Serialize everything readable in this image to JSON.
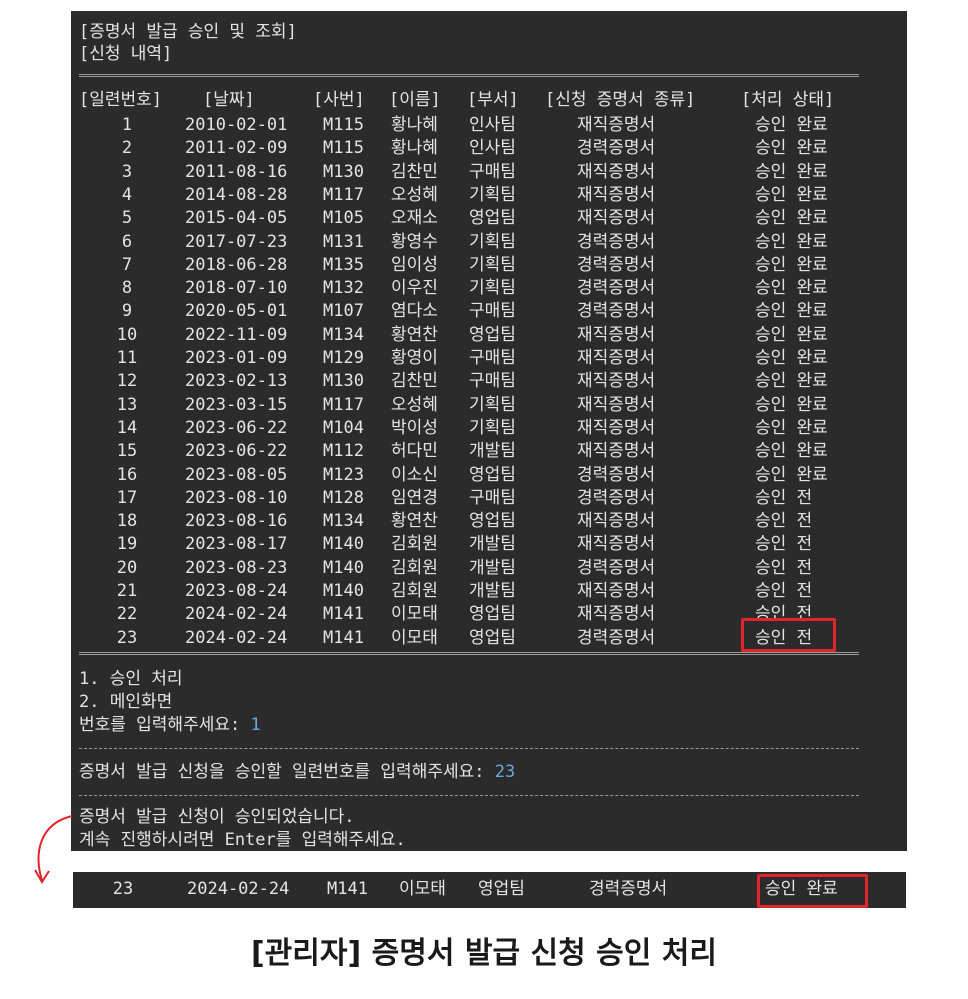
{
  "terminal": {
    "title": "[증명서 발급 승인 및 조회]",
    "subtitle": "[신청 내역]",
    "headers": [
      "[일련번호]",
      "[날짜]",
      "[사번]",
      "[이름]",
      "[부서]",
      "[신청 증명서 종류]",
      "[처리 상태]"
    ],
    "rows": [
      {
        "seq": "1",
        "date": "2010-02-01",
        "emp": "M115",
        "name": "황나혜",
        "dept": "인사팀",
        "type": "재직증명서",
        "status": "승인 완료"
      },
      {
        "seq": "2",
        "date": "2011-02-09",
        "emp": "M115",
        "name": "황나혜",
        "dept": "인사팀",
        "type": "경력증명서",
        "status": "승인 완료"
      },
      {
        "seq": "3",
        "date": "2011-08-16",
        "emp": "M130",
        "name": "김찬민",
        "dept": "구매팀",
        "type": "재직증명서",
        "status": "승인 완료"
      },
      {
        "seq": "4",
        "date": "2014-08-28",
        "emp": "M117",
        "name": "오성혜",
        "dept": "기획팀",
        "type": "재직증명서",
        "status": "승인 완료"
      },
      {
        "seq": "5",
        "date": "2015-04-05",
        "emp": "M105",
        "name": "오재소",
        "dept": "영업팀",
        "type": "재직증명서",
        "status": "승인 완료"
      },
      {
        "seq": "6",
        "date": "2017-07-23",
        "emp": "M131",
        "name": "황영수",
        "dept": "기획팀",
        "type": "경력증명서",
        "status": "승인 완료"
      },
      {
        "seq": "7",
        "date": "2018-06-28",
        "emp": "M135",
        "name": "임이성",
        "dept": "기획팀",
        "type": "경력증명서",
        "status": "승인 완료"
      },
      {
        "seq": "8",
        "date": "2018-07-10",
        "emp": "M132",
        "name": "이우진",
        "dept": "기획팀",
        "type": "경력증명서",
        "status": "승인 완료"
      },
      {
        "seq": "9",
        "date": "2020-05-01",
        "emp": "M107",
        "name": "염다소",
        "dept": "구매팀",
        "type": "경력증명서",
        "status": "승인 완료"
      },
      {
        "seq": "10",
        "date": "2022-11-09",
        "emp": "M134",
        "name": "황연찬",
        "dept": "영업팀",
        "type": "재직증명서",
        "status": "승인 완료"
      },
      {
        "seq": "11",
        "date": "2023-01-09",
        "emp": "M129",
        "name": "황영이",
        "dept": "구매팀",
        "type": "재직증명서",
        "status": "승인 완료"
      },
      {
        "seq": "12",
        "date": "2023-02-13",
        "emp": "M130",
        "name": "김찬민",
        "dept": "구매팀",
        "type": "재직증명서",
        "status": "승인 완료"
      },
      {
        "seq": "13",
        "date": "2023-03-15",
        "emp": "M117",
        "name": "오성혜",
        "dept": "기획팀",
        "type": "재직증명서",
        "status": "승인 완료"
      },
      {
        "seq": "14",
        "date": "2023-06-22",
        "emp": "M104",
        "name": "박이성",
        "dept": "기획팀",
        "type": "재직증명서",
        "status": "승인 완료"
      },
      {
        "seq": "15",
        "date": "2023-06-22",
        "emp": "M112",
        "name": "허다민",
        "dept": "개발팀",
        "type": "재직증명서",
        "status": "승인 완료"
      },
      {
        "seq": "16",
        "date": "2023-08-05",
        "emp": "M123",
        "name": "이소신",
        "dept": "영업팀",
        "type": "경력증명서",
        "status": "승인 완료"
      },
      {
        "seq": "17",
        "date": "2023-08-10",
        "emp": "M128",
        "name": "임연경",
        "dept": "구매팀",
        "type": "경력증명서",
        "status": "승인 전"
      },
      {
        "seq": "18",
        "date": "2023-08-16",
        "emp": "M134",
        "name": "황연찬",
        "dept": "영업팀",
        "type": "재직증명서",
        "status": "승인 전"
      },
      {
        "seq": "19",
        "date": "2023-08-17",
        "emp": "M140",
        "name": "김회원",
        "dept": "개발팀",
        "type": "재직증명서",
        "status": "승인 전"
      },
      {
        "seq": "20",
        "date": "2023-08-23",
        "emp": "M140",
        "name": "김회원",
        "dept": "개발팀",
        "type": "경력증명서",
        "status": "승인 전"
      },
      {
        "seq": "21",
        "date": "2023-08-24",
        "emp": "M140",
        "name": "김회원",
        "dept": "개발팀",
        "type": "재직증명서",
        "status": "승인 전"
      },
      {
        "seq": "22",
        "date": "2024-02-24",
        "emp": "M141",
        "name": "이모태",
        "dept": "영업팀",
        "type": "재직증명서",
        "status": "승인 전"
      },
      {
        "seq": "23",
        "date": "2024-02-24",
        "emp": "M141",
        "name": "이모태",
        "dept": "영업팀",
        "type": "경력증명서",
        "status": "승인 전"
      }
    ],
    "menu": [
      "1. 승인 처리",
      "2. 메인화면"
    ],
    "prompt1": {
      "label": "번호를 입력해주세요: ",
      "value": "1"
    },
    "prompt2": {
      "label": "증명서 발급 신청을 승인할 일련번호를 입력해주세요: ",
      "value": "23"
    },
    "message": "증명서 발급 신청이 승인되었습니다.",
    "continue": "계속 진행하시려면 Enter를 입력해주세요."
  },
  "result_row": {
    "seq": "23",
    "date": "2024-02-24",
    "emp": "M141",
    "name": "이모태",
    "dept": "영업팀",
    "type": "경력증명서",
    "status": "승인 완료"
  },
  "caption": "[관리자] 증명서 발급 신청 승인 처리",
  "colors": {
    "highlight": "#e0262b",
    "terminal_bg": "#2b2b2b",
    "input_text": "#6aa8e0"
  }
}
